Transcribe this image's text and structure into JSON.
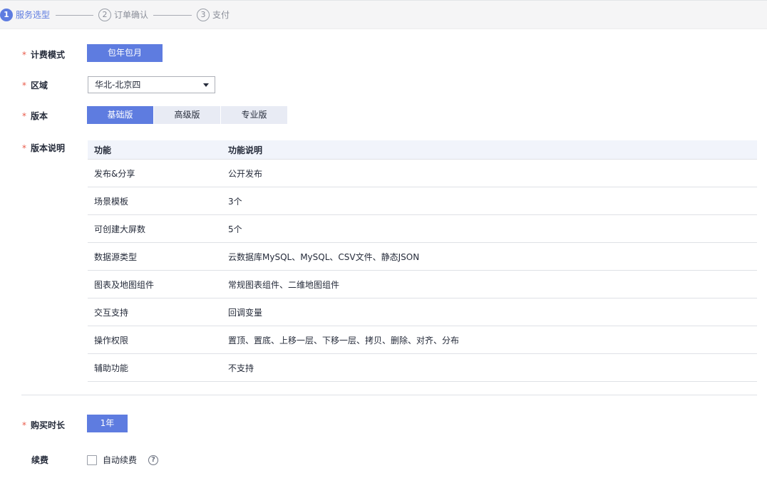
{
  "steps": [
    {
      "num": "1",
      "label": "服务选型",
      "active": true
    },
    {
      "num": "2",
      "label": "订单确认",
      "active": false
    },
    {
      "num": "3",
      "label": "支付",
      "active": false
    }
  ],
  "required_mark": "*",
  "billing": {
    "label": "计费模式",
    "option": "包年包月"
  },
  "region": {
    "label": "区域",
    "value": "华北-北京四"
  },
  "edition": {
    "label": "版本",
    "options": [
      "基础版",
      "高级版",
      "专业版"
    ],
    "selected": "基础版"
  },
  "edition_desc": {
    "label": "版本说明",
    "headers": [
      "功能",
      "功能说明"
    ],
    "rows": [
      [
        "发布&分享",
        "公开发布"
      ],
      [
        "场景模板",
        "3个"
      ],
      [
        "可创建大屏数",
        "5个"
      ],
      [
        "数据源类型",
        "云数据库MySQL、MySQL、CSV文件、静态JSON"
      ],
      [
        "图表及地图组件",
        "常规图表组件、二维地图组件"
      ],
      [
        "交互支持",
        "回调变量"
      ],
      [
        "操作权限",
        "置顶、置底、上移一层、下移一层、拷贝、删除、对齐、分布"
      ],
      [
        "辅助功能",
        "不支持"
      ]
    ]
  },
  "duration": {
    "label": "购买时长",
    "option": "1年"
  },
  "renewal": {
    "label": "续费",
    "checkbox_label": "自动续费",
    "checked": false,
    "help_glyph": "?"
  },
  "colors": {
    "primary": "#5e7ce0",
    "required": "#e95b4b",
    "table_header_bg": "#f1f4fb"
  }
}
